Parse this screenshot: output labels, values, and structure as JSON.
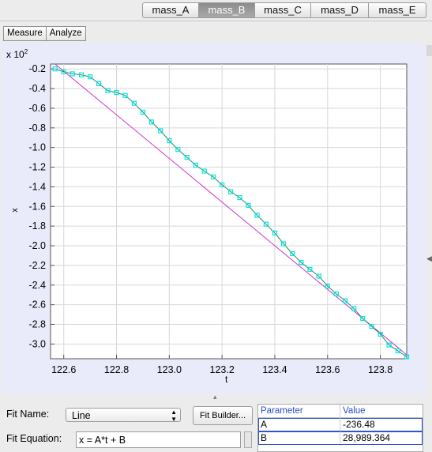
{
  "tabs": [
    {
      "label": "mass_A",
      "active": false
    },
    {
      "label": "mass_B",
      "active": true
    },
    {
      "label": "mass_C",
      "active": false
    },
    {
      "label": "mass_D",
      "active": false
    },
    {
      "label": "mass_E",
      "active": false
    }
  ],
  "toolbar": {
    "measure_label": "Measure",
    "analyze_label": "Analyze"
  },
  "plot": {
    "scale_prefix": "x 10",
    "scale_exponent": "2",
    "background_color": "#e9ebfb",
    "data_color": "#00e5e5",
    "fit_color": "#cc33cc",
    "smooth_color": "#2e8b57"
  },
  "chart_data": {
    "type": "scatter",
    "xlabel": "t",
    "ylabel": "x",
    "xlim": [
      122.55,
      123.9
    ],
    "ylim": [
      -3.15,
      -0.15
    ],
    "xticks": [
      "122.6",
      "122.8",
      "123.0",
      "123.2",
      "123.4",
      "123.6",
      "123.8"
    ],
    "yticks": [
      "-0.2",
      "-0.4",
      "-0.6",
      "-0.8",
      "-1.0",
      "-1.2",
      "-1.4",
      "-1.6",
      "-1.8",
      "-2.0",
      "-2.2",
      "-2.4",
      "-2.6",
      "-2.8",
      "-3.0"
    ],
    "grid": true,
    "series": [
      {
        "x": [
          122.567,
          122.6,
          122.633,
          122.667,
          122.7,
          122.733,
          122.767,
          122.8,
          122.833,
          122.867,
          122.9,
          122.933,
          122.967,
          123.0,
          123.033,
          123.067,
          123.1,
          123.133,
          123.167,
          123.2,
          123.233,
          123.267,
          123.3,
          123.333,
          123.367,
          123.4,
          123.433,
          123.467,
          123.5,
          123.533,
          123.567,
          123.6,
          123.633,
          123.667,
          123.7,
          123.733,
          123.767,
          123.8,
          123.833,
          123.867,
          123.9
        ],
        "y": [
          -0.2,
          -0.23,
          -0.25,
          -0.26,
          -0.28,
          -0.35,
          -0.42,
          -0.44,
          -0.47,
          -0.55,
          -0.64,
          -0.74,
          -0.83,
          -0.93,
          -1.02,
          -1.1,
          -1.18,
          -1.24,
          -1.3,
          -1.38,
          -1.45,
          -1.51,
          -1.59,
          -1.69,
          -1.78,
          -1.87,
          -1.98,
          -2.08,
          -2.17,
          -2.24,
          -2.31,
          -2.41,
          -2.49,
          -2.56,
          -2.64,
          -2.74,
          -2.82,
          -2.9,
          -3.01,
          -3.07,
          -3.13
        ]
      }
    ],
    "fit_line": {
      "x": [
        122.567,
        123.9
      ],
      "y": [
        -0.15,
        -3.11
      ]
    }
  },
  "fit": {
    "name_label": "Fit Name:",
    "name_value": "Line",
    "builder_label": "Fit Builder...",
    "equation_label": "Fit Equation:",
    "equation_value": "x = A*t + B"
  },
  "params": {
    "header": [
      "Parameter",
      "Value"
    ],
    "rows": [
      {
        "name": "A",
        "value": "-236.48"
      },
      {
        "name": "B",
        "value": "28,989.364"
      }
    ]
  }
}
